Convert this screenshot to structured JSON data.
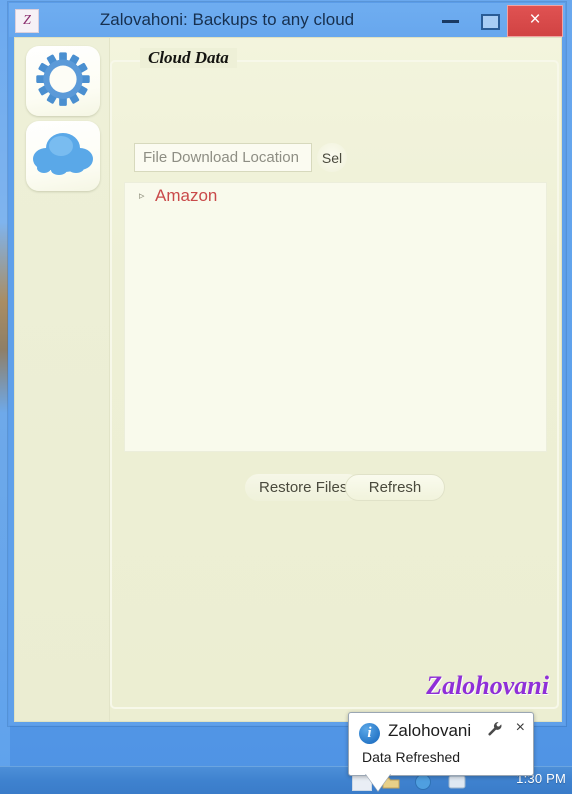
{
  "window": {
    "title": "Zalovahoni: Backups to any cloud",
    "app_icon_letter": "Z",
    "minimize_label": "Minimize",
    "maximize_label": "Maximize",
    "close_label": "×"
  },
  "sidebar": {
    "items": [
      {
        "name": "settings",
        "icon": "gear-icon"
      },
      {
        "name": "cloud",
        "icon": "cloud-icon"
      }
    ]
  },
  "main": {
    "groupbox_title": "Cloud Data",
    "path_field": {
      "value": "",
      "placeholder": "File Download Location"
    },
    "select_button_label": "Sel",
    "tree": {
      "items": [
        {
          "label": "Amazon",
          "expander": "▹",
          "expanded": false,
          "color": "#c94a4a"
        }
      ]
    },
    "actions": {
      "restore_label": "Restore Files",
      "refresh_label": "Refresh"
    },
    "watermark": "Zalohovani"
  },
  "toast": {
    "title": "Zalohovani",
    "body": "Data Refreshed",
    "info_glyph": "i",
    "close_glyph": "×"
  },
  "taskbar": {
    "clock": "1:30 PM"
  },
  "colors": {
    "desktop_blue": "#5fa2ec",
    "client_cream": "#eef0d7",
    "accent_red": "#c94a4a",
    "watermark_purple": "#8f2fd8",
    "close_red": "#d14343",
    "icon_blue": "#4a90d9"
  }
}
